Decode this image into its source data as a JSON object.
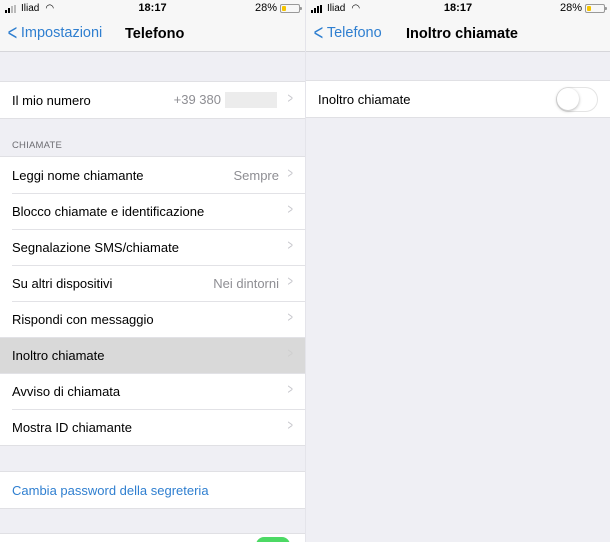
{
  "left_screen": {
    "status_bar": {
      "carrier": "Iliad",
      "time": "18:17",
      "battery_percent_label": "28%",
      "battery_level": 0.28,
      "signal_bars_active": 2,
      "signal_bars_total": 4
    },
    "nav": {
      "back_label": "Impostazioni",
      "title": "Telefono"
    },
    "my_number": {
      "label": "Il mio numero",
      "value": "+39 380"
    },
    "calls_section": {
      "header": "CHIAMATE",
      "items": [
        {
          "label": "Leggi nome chiamante",
          "value": "Sempre"
        },
        {
          "label": "Blocco chiamate e identificazione",
          "value": ""
        },
        {
          "label": "Segnalazione SMS/chiamate",
          "value": ""
        },
        {
          "label": "Su altri dispositivi",
          "value": "Nei dintorni"
        },
        {
          "label": "Rispondi con messaggio",
          "value": ""
        },
        {
          "label": "Inoltro chiamate",
          "value": "",
          "selected": true
        },
        {
          "label": "Avviso di chiamata",
          "value": ""
        },
        {
          "label": "Mostra ID chiamante",
          "value": ""
        }
      ]
    },
    "voicemail": {
      "label": "Cambia password della segreteria"
    },
    "colors": {
      "accent": "#2f7fd0",
      "background": "#efeff4",
      "selected_row": "#d9d9d9",
      "toggle_on": "#4cd964",
      "battery": "#f5c400"
    }
  },
  "right_screen": {
    "status_bar": {
      "carrier": "Iliad",
      "time": "18:17",
      "battery_percent_label": "28%",
      "battery_level": 0.28,
      "signal_bars_active": 4,
      "signal_bars_total": 4
    },
    "nav": {
      "back_label": "Telefono",
      "title": "Inoltro chiamate"
    },
    "forwarding": {
      "label": "Inoltro chiamate",
      "enabled": false
    }
  },
  "icons": {
    "back": "chevron-left-icon",
    "disclosure": "chevron-right-icon",
    "wifi": "wifi-icon",
    "signal": "signal-icon",
    "battery": "battery-icon"
  }
}
